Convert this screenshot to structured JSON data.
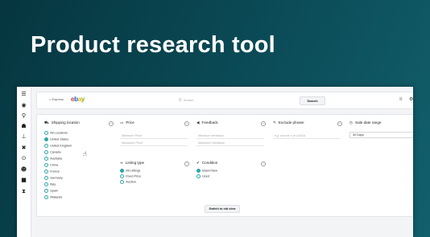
{
  "headline": "Product research tool",
  "sidebar": {
    "icons": [
      "menu-icon",
      "eye-icon",
      "search-icon",
      "person-icon",
      "sitemap-icon",
      "tools-icon",
      "target-icon",
      "add-user-icon",
      "folder-icon",
      "hourglass-icon"
    ]
  },
  "topbar": {
    "back_label": "< Express",
    "logo_letters": [
      "e",
      "b",
      "a",
      "y"
    ],
    "search_placeholder": "Search",
    "search_button": "Search"
  },
  "filters": {
    "shipping": {
      "title": "Shipping location",
      "options": [
        {
          "label": "All Locations",
          "selected": false
        },
        {
          "label": "United States",
          "selected": true
        },
        {
          "label": "United Kingdom",
          "selected": false
        },
        {
          "label": "Canada",
          "selected": false
        },
        {
          "label": "Australia",
          "selected": false
        },
        {
          "label": "China",
          "selected": false
        },
        {
          "label": "France",
          "selected": false
        },
        {
          "label": "Germany",
          "selected": false
        },
        {
          "label": "Italy",
          "selected": false
        },
        {
          "label": "Spain",
          "selected": false
        },
        {
          "label": "Malaysia",
          "selected": false
        }
      ]
    },
    "price": {
      "title": "Price",
      "min_placeholder": "Minimum Price",
      "max_placeholder": "Maximum Price"
    },
    "feedback": {
      "title": "Feedback",
      "min_placeholder": "Minimum feedback",
      "max_placeholder": "Maximum feedback"
    },
    "exclude": {
      "title": "Exclude phrase",
      "placeholder": "e.g. iphone x or 4x32A"
    },
    "sale_date": {
      "title": "Sale date range",
      "value": "30 Days"
    },
    "listing_type": {
      "title": "Listing type",
      "options": [
        {
          "label": "All Listings",
          "selected": true
        },
        {
          "label": "Fixed Price",
          "selected": false
        },
        {
          "label": "Auction",
          "selected": false
        }
      ]
    },
    "condition": {
      "title": "Condition",
      "options": [
        {
          "label": "Brand New",
          "selected": true
        },
        {
          "label": "Used",
          "selected": false
        }
      ]
    },
    "switch_button": "Switch to old view"
  }
}
